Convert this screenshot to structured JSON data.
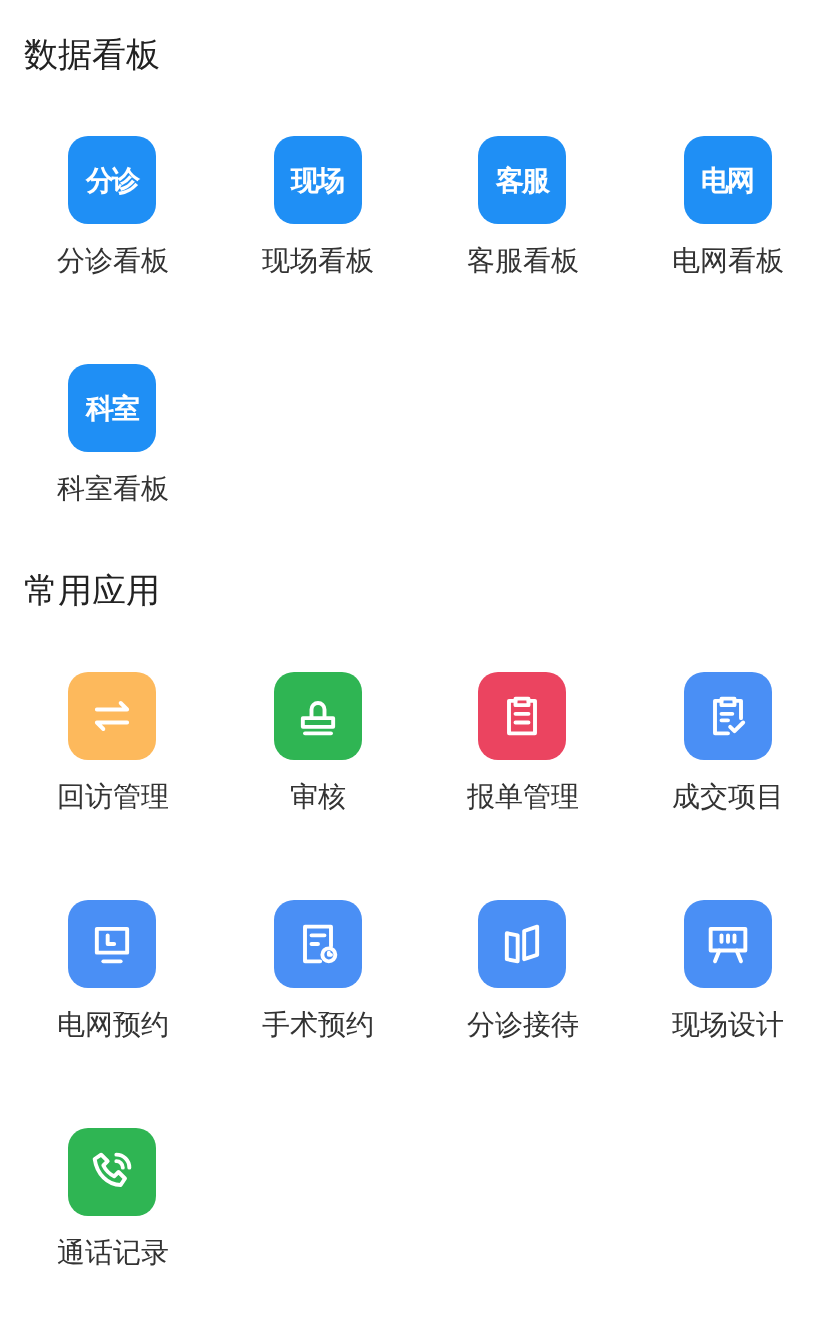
{
  "dashboards": {
    "title": "数据看板",
    "items": [
      {
        "badge": "分诊",
        "label": "分诊看板"
      },
      {
        "badge": "现场",
        "label": "现场看板"
      },
      {
        "badge": "客服",
        "label": "客服看板"
      },
      {
        "badge": "电网",
        "label": "电网看板"
      },
      {
        "badge": "科室",
        "label": "科室看板"
      }
    ]
  },
  "apps": {
    "title": "常用应用",
    "items": [
      {
        "kind": "exchange",
        "color": "#fdb95c",
        "label": "回访管理"
      },
      {
        "kind": "stamp",
        "color": "#2fb553",
        "label": "审核"
      },
      {
        "kind": "clipboard",
        "color": "#eb4460",
        "label": "报单管理"
      },
      {
        "kind": "clipboard-check",
        "color": "#4a8ff5",
        "label": "成交项目"
      },
      {
        "kind": "monitor",
        "color": "#4a8ff5",
        "label": "电网预约"
      },
      {
        "kind": "document-clock",
        "color": "#4a8ff5",
        "label": "手术预约"
      },
      {
        "kind": "panels",
        "color": "#4a8ff5",
        "label": "分诊接待"
      },
      {
        "kind": "easel",
        "color": "#4a8ff5",
        "label": "现场设计"
      },
      {
        "kind": "phone",
        "color": "#2fb553",
        "label": "通话记录"
      }
    ]
  }
}
